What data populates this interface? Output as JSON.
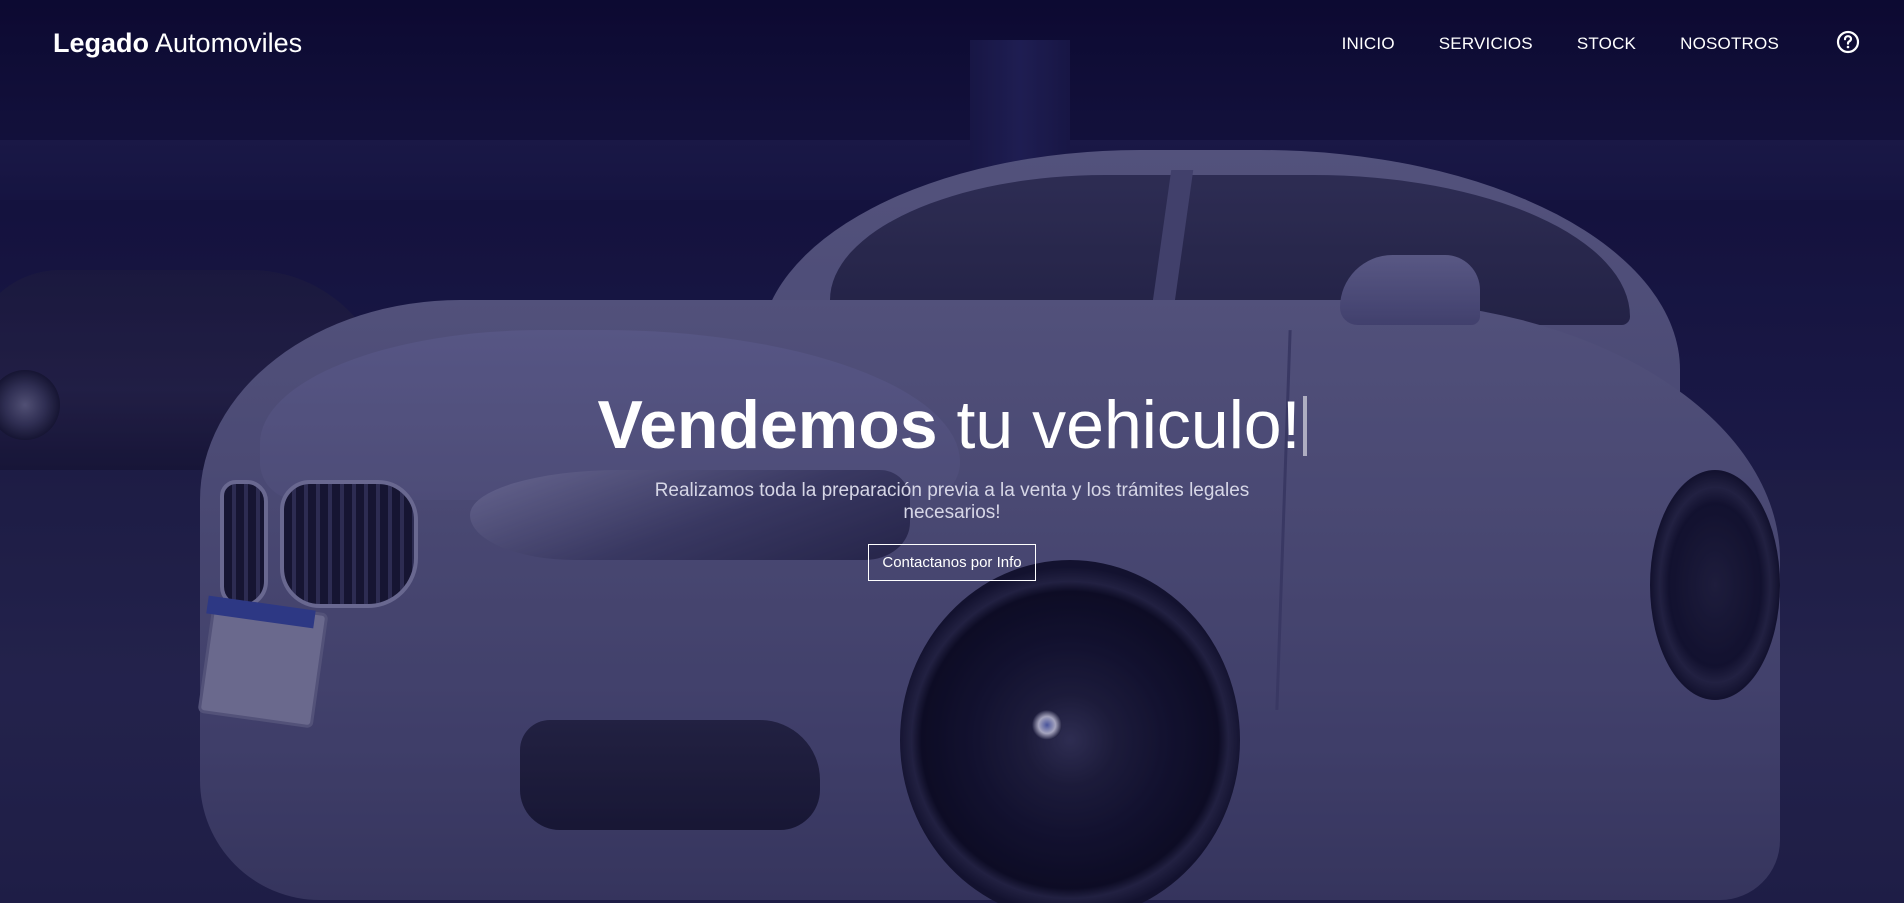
{
  "brand": {
    "bold": "Legado",
    "light": "Automoviles"
  },
  "nav": {
    "items": [
      {
        "label": "INICIO"
      },
      {
        "label": "SERVICIOS"
      },
      {
        "label": "STOCK"
      },
      {
        "label": "NOSOTROS"
      }
    ],
    "help_icon": "question-circle-icon"
  },
  "hero": {
    "title_bold": "Vendemos",
    "title_light": "tu vehiculo!",
    "subtitle": "Realizamos toda la preparación previa a la venta y los trámites legales necesarios!",
    "cta_label": "Contactanos por Info"
  },
  "colors": {
    "overlay": "#1b1a45",
    "text": "#ffffff",
    "subtitle": "#d6d6e6"
  }
}
